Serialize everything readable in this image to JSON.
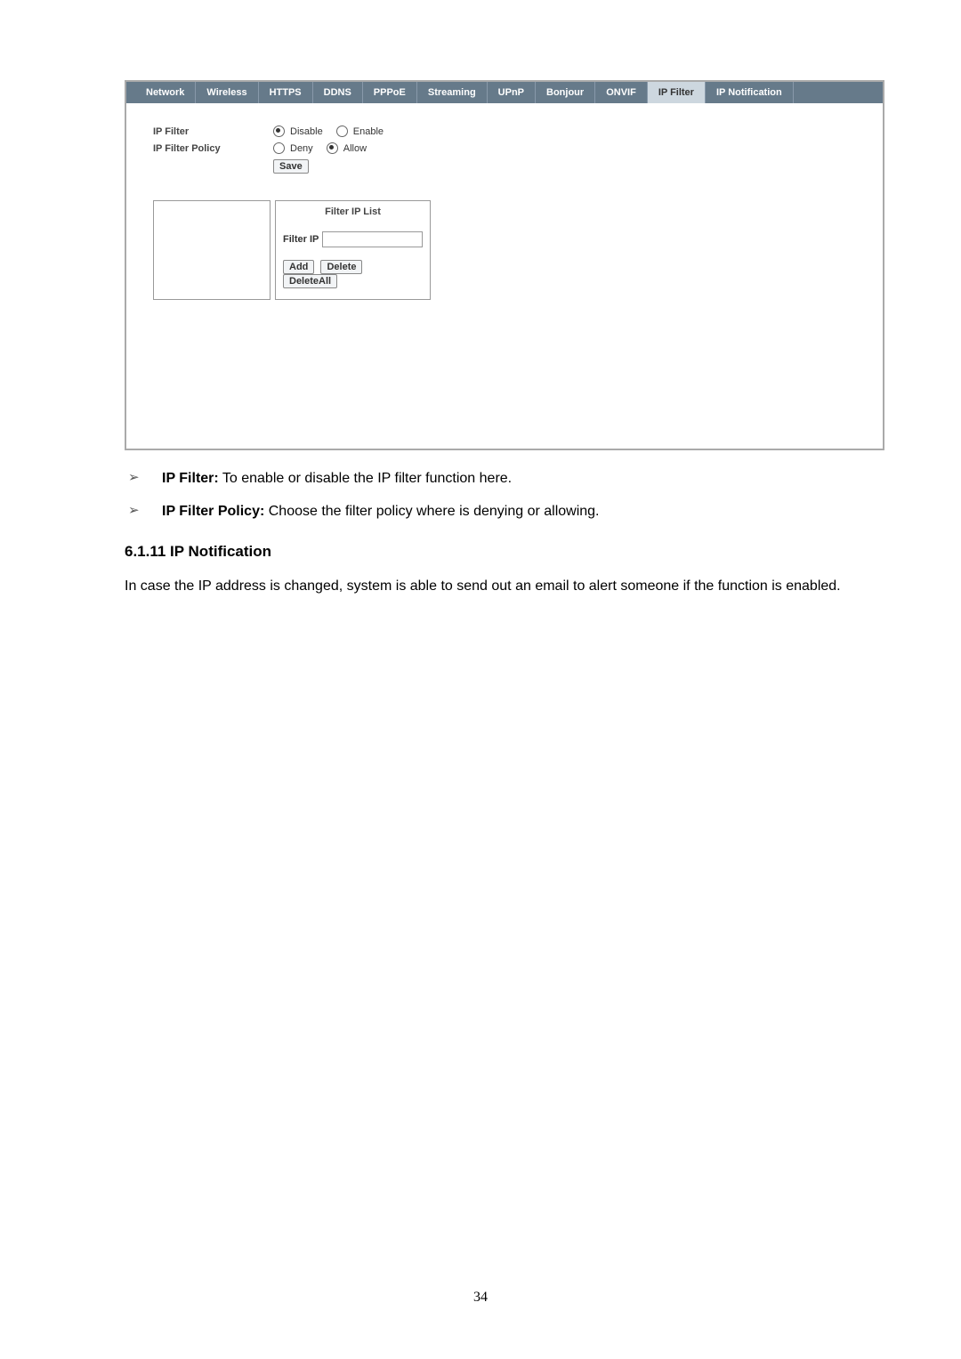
{
  "tabs": [
    "Network",
    "Wireless",
    "HTTPS",
    "DDNS",
    "PPPoE",
    "Streaming",
    "UPnP",
    "Bonjour",
    "ONVIF",
    "IP Filter",
    "IP Notification"
  ],
  "activeTab": "IP Filter",
  "form": {
    "filterLabel": "IP Filter",
    "policyLabel": "IP Filter Policy",
    "disableLabel": "Disable",
    "enableLabel": "Enable",
    "denyLabel": "Deny",
    "allowLabel": "Allow",
    "saveBtn": "Save"
  },
  "filterBox": {
    "title": "Filter IP List",
    "inputLabel": "Filter IP",
    "addBtn": "Add",
    "deleteBtn": "Delete",
    "deleteAllBtn": "DeleteAll"
  },
  "doc": {
    "bullet1_bold": "IP Filter:",
    "bullet1_text": " To enable or disable the IP filter function here.",
    "bullet2_bold": "IP Filter Policy:",
    "bullet2_text": " Choose the filter policy where is denying or allowing.",
    "heading": "6.1.11 IP Notification",
    "paragraph": "In case the IP address is changed, system is able to send out an email to alert someone if the function is enabled."
  },
  "pageNumber": "34"
}
